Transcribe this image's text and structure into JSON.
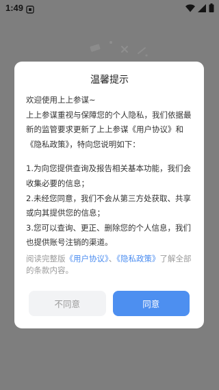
{
  "status_bar": {
    "time": "1:49",
    "left_icons": [
      "notification-icon"
    ],
    "right_icons": [
      "wifi-icon",
      "signal-icon",
      "battery-icon"
    ]
  },
  "dialog": {
    "title": "温馨提示",
    "greeting": "欢迎使用上上参谋~",
    "intro_lines": [
      "上上参谋重视与保障您的个人隐私，我们依据最",
      "新的监管要求更新了上上参谋《用户协议》和",
      "《隐私政策》，特向您说明如下："
    ],
    "items": [
      [
        "1.为向您提供查询及报告相关基本功能，我们会",
        "收集必要的信息；"
      ],
      [
        "2.未经您同意，我们不会从第三方处获取、共享",
        "或向其提供您的信息；"
      ],
      [
        "3.您可以查询、更正、删除您的个人信息，我们",
        "也提供账号注销的渠道。"
      ]
    ],
    "footer": {
      "prefix": "阅读完整版",
      "user_agreement_link": "《用户协议》",
      "separator": "、",
      "privacy_policy_link": "《隐私政策》",
      "suffix": "了解全部的条款内容。"
    },
    "buttons": {
      "disagree": "不同意",
      "agree": "同意"
    }
  },
  "colors": {
    "overlay": "#7e7e7e",
    "accent": "#4d8ff0",
    "link": "#4a8cf0",
    "muted_text": "#9a9a9a",
    "disagree_bg": "#f2f3f5"
  }
}
